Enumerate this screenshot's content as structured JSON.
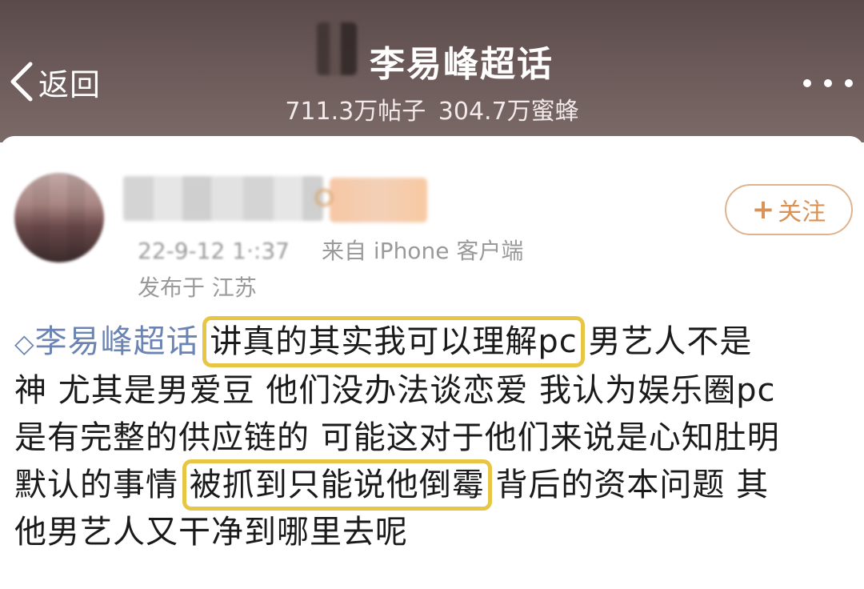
{
  "header": {
    "back_label": "返回",
    "title": "李易峰超话",
    "stats": {
      "posts": "711.3万帖子",
      "members": "304.7万蜜蜂"
    },
    "more_label": "•••"
  },
  "post": {
    "meta": {
      "time": "22-9-12 1·:37",
      "source": "来自 iPhone 客户端",
      "location": "发布于 江苏"
    },
    "follow_label": "关注",
    "follow_plus": "+",
    "topic_icon": "◇",
    "topic": "李易峰超话",
    "lines": [
      {
        "highlight": "讲真的其实我可以理解pc",
        "rest": "男艺人不是"
      },
      "神 尤其是男爱豆 他们没办法谈恋爱 我认为娱乐圈pc",
      "是有完整的供应链的 可能这对于他们来说是心知肚明",
      {
        "before": "默认的事情",
        "highlight": "被抓到只能说他倒霉",
        "after": "背后的资本问题 其"
      },
      "他男艺人又干净到哪里去呢"
    ]
  },
  "colors": {
    "header_bg": "#6a5958",
    "topic_link": "#6b84b3",
    "highlight_box": "#e7c646",
    "follow_accent": "#d99256",
    "meta_gray": "#9a9a9a"
  },
  "icons": {
    "back": "chevron-left-icon",
    "more": "more-dots-icon",
    "topic": "diamond-icon",
    "follow": "plus-icon"
  }
}
